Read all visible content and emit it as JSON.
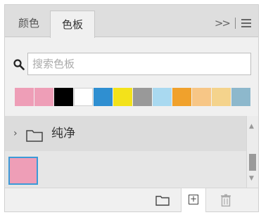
{
  "tabs": [
    {
      "label": "颜色",
      "active": false
    },
    {
      "label": "色板",
      "active": true
    }
  ],
  "tab_bar_icons": {
    "expand": "double-chevron-right-icon",
    "menu": "hamburger-menu-icon"
  },
  "search": {
    "placeholder": "搜索色板",
    "value": ""
  },
  "recent_swatches": [
    "#ee9eb7",
    "#ee9eb7",
    "#000000",
    "#ffffff",
    "#2f8fd1",
    "#f3e21a",
    "#999999",
    "#a9d9f0",
    "#f0a12c",
    "#f7c686",
    "#f4d38c",
    "#8db8cc"
  ],
  "group": {
    "name": "纯净",
    "expanded": false,
    "color": "#ee9eb7"
  },
  "selected_swatch_color": "#ee9eb7",
  "bottom_toolbar": {
    "new_group": "folder-icon",
    "new_swatch": "plus-square-icon",
    "delete": "trash-icon"
  }
}
